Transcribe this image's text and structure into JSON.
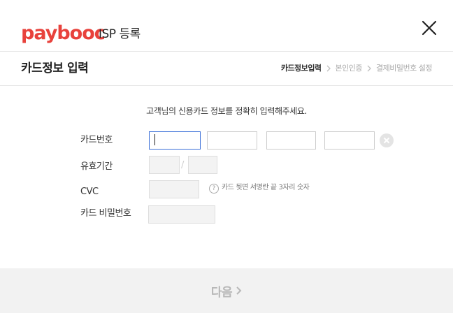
{
  "header": {
    "logo_text": "paybooc",
    "title": "ISP 등록",
    "close_icon": "close-icon"
  },
  "subheader": {
    "page_title": "카드정보 입력",
    "steps": [
      {
        "label": "카드정보입력",
        "active": true
      },
      {
        "label": "본인인증",
        "active": false
      },
      {
        "label": "결제비밀번호 설정",
        "active": false
      }
    ]
  },
  "form": {
    "intro": "고객님의 신용카드 정보를 정확히 입력해주세요.",
    "card_number_label": "카드번호",
    "card_number_values": [
      "",
      "",
      "",
      ""
    ],
    "expiry_label": "유효기간",
    "expiry_separator": "/",
    "cvc_label": "CVC",
    "cvc_help": "카드 뒷면 서명란 끝 3자리 숫자",
    "pin_label": "카드 비밀번호"
  },
  "footer": {
    "next_label": "다음",
    "next_icon": "chevron-right-icon"
  },
  "colors": {
    "brand": "#e8423c",
    "focus": "#3a6fd8",
    "footer_bg": "#f2f2f2"
  }
}
